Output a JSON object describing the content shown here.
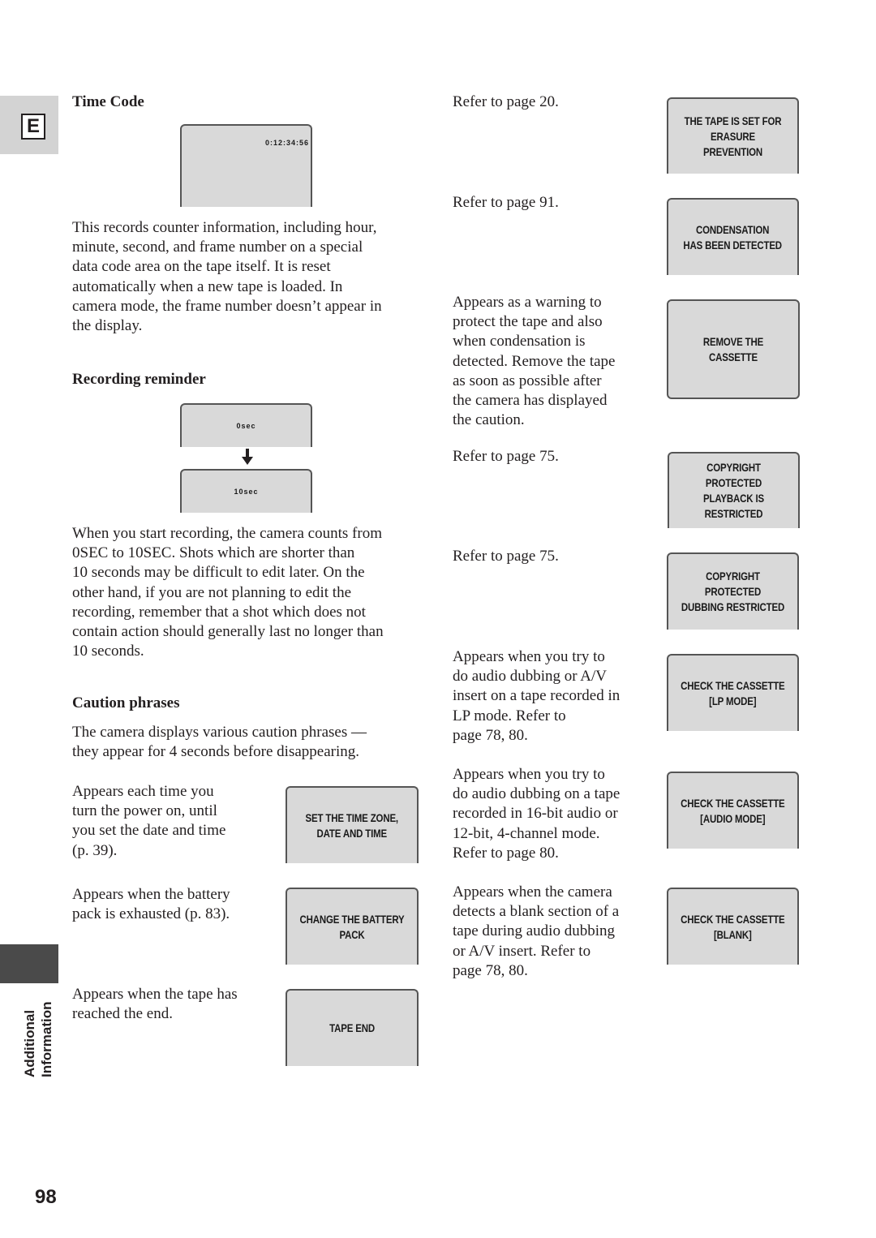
{
  "sidebar": {
    "language_tab": "E",
    "section_label_line1": "Additional",
    "section_label_line2": "Information",
    "page_number": "98"
  },
  "left": {
    "time_code": {
      "heading": "Time Code",
      "display": "0:12:34:56",
      "body": "This records counter information, including hour,\nminute, second, and frame number on a special\ndata code area on the tape itself. It is reset\nautomatically when a new tape is loaded. In\ncamera mode, the frame number doesn’t appear in\nthe display."
    },
    "recording_reminder": {
      "heading": "Recording reminder",
      "display_start": "0sec",
      "display_end": "10sec",
      "body": "When you start recording, the camera counts from\n0SEC to 10SEC. Shots which are shorter than\n10 seconds may be difficult to edit later. On the\nother hand, if you are not planning to edit the\nrecording, remember that a shot which does not\ncontain action should generally last no longer than\n10 seconds."
    },
    "caution_phrases": {
      "heading": "Caution phrases",
      "intro": "The camera displays various caution phrases —\nthey appear for 4 seconds before disappearing.",
      "items": [
        {
          "description": "Appears each time you\nturn the power on, until\nyou set the date and time\n(p. 39).",
          "display": "SET THE TIME ZONE,\nDATE AND TIME"
        },
        {
          "description": "Appears when the battery\npack is exhausted (p. 83).",
          "display": "CHANGE THE BATTERY PACK"
        },
        {
          "description": "Appears when the tape has\nreached the end.",
          "display": "TAPE END"
        }
      ]
    }
  },
  "right": {
    "items": [
      {
        "description": "Refer to page 20.",
        "display": "THE TAPE IS SET FOR\nERASURE PREVENTION"
      },
      {
        "description": "Refer to page 91.",
        "display": "CONDENSATION\nHAS BEEN DETECTED"
      },
      {
        "description": "Appears as a warning to\nprotect the tape and also\nwhen condensation is\ndetected. Remove the tape\nas soon as possible after\nthe camera has displayed\nthe caution.",
        "display": "REMOVE THE CASSETTE"
      },
      {
        "description": "Refer to page 75.",
        "display": "COPYRIGHT PROTECTED\nPLAYBACK IS RESTRICTED"
      },
      {
        "description": "Refer to page 75.",
        "display": "COPYRIGHT PROTECTED\nDUBBING RESTRICTED"
      },
      {
        "description": "Appears when you try to\ndo audio dubbing or A/V\ninsert on a tape recorded in\nLP mode. Refer to\npage 78, 80.",
        "display": "CHECK THE CASSETTE\n[LP MODE]"
      },
      {
        "description": "Appears when you try to\ndo audio dubbing on a tape\nrecorded in 16-bit audio or\n12-bit, 4-channel mode.\nRefer to page 80.",
        "display": "CHECK THE CASSETTE\n[AUDIO MODE]"
      },
      {
        "description": "Appears when the camera\ndetects a blank section of a\ntape during audio dubbing\nor A/V insert. Refer to\npage 78, 80.",
        "display": "CHECK THE CASSETTE\n[BLANK]"
      }
    ]
  }
}
